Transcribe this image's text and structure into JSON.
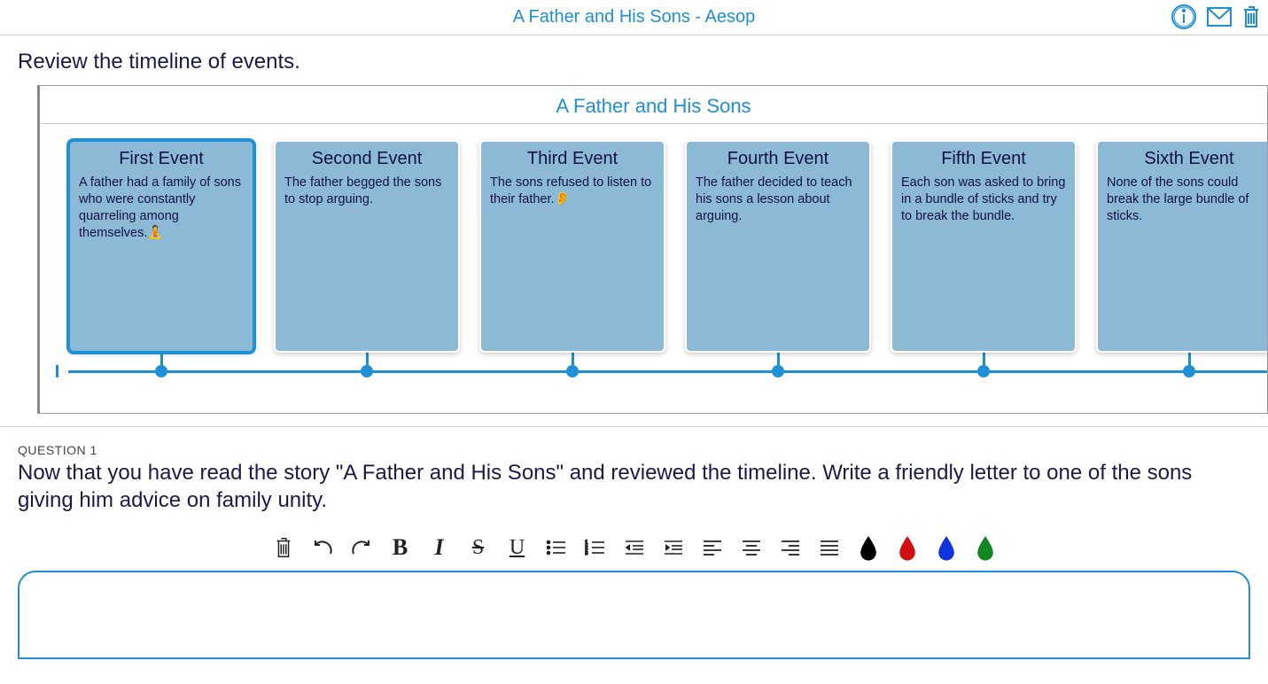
{
  "header": {
    "title": "A Father and His Sons - Aesop"
  },
  "instruction": "Review the timeline of events.",
  "timeline": {
    "title": "A Father and His Sons",
    "events": [
      {
        "title": "First Event",
        "desc": "A father had a family of sons who were constantly quarreling among themselves.",
        "emoji": "🧘"
      },
      {
        "title": "Second Event",
        "desc": "The father begged the sons to stop arguing.",
        "emoji": ""
      },
      {
        "title": "Third Event",
        "desc": "The sons refused to listen to their father.",
        "emoji": "👂"
      },
      {
        "title": "Fourth Event",
        "desc": "The father decided to teach his sons a lesson about arguing.",
        "emoji": ""
      },
      {
        "title": "Fifth Event",
        "desc": "Each son was asked to bring in a bundle of sticks and try to break the bundle.",
        "emoji": ""
      },
      {
        "title": "Sixth Event",
        "desc": "None of the sons could break the large bundle of sticks.",
        "emoji": ""
      }
    ]
  },
  "question": {
    "label": "QUESTION 1",
    "text": "Now that you have read the story \"A Father and His Sons\" and reviewed the timeline. Write a friendly letter to one of the sons giving him advice on family unity."
  },
  "toolbar": {
    "bold": "B",
    "italic": "I",
    "strike": "S",
    "underline": "U",
    "colors": [
      "#000000",
      "#d11111",
      "#1133dd",
      "#118822"
    ]
  },
  "editor": {
    "content": ""
  }
}
